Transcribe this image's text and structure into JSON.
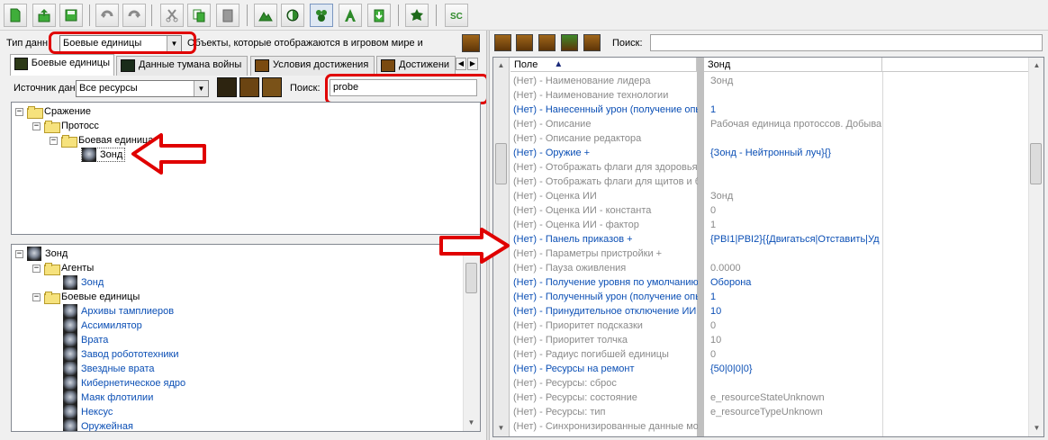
{
  "toolbar": {
    "buttons": [
      "new-file-icon",
      "open-file-icon",
      "save-icon",
      "undo-icon",
      "redo-icon",
      "cut-icon",
      "copy-icon",
      "paste-icon",
      "terrain-icon",
      "doodad-icon",
      "data-module-icon",
      "text-module-icon",
      "import-icon",
      "trigger-icon",
      "script-icon"
    ]
  },
  "left": {
    "data_type_label": "Тип данн",
    "data_type_value": "Боевые единицы",
    "data_type_desc": "Объекты, которые отображаются в игровом мире и",
    "tabs": [
      "Боевые единицы",
      "Данные тумана войны",
      "Условия достижения",
      "Достижени"
    ],
    "source_label": "Источник дан",
    "source_value": "Все ресурсы",
    "search_label": "Поиск:",
    "search_value": "probe",
    "tree": [
      {
        "label": "Сражение",
        "level": 0,
        "expander": "−"
      },
      {
        "label": "Протосс",
        "level": 1,
        "expander": "−"
      },
      {
        "label": "Боевая единица",
        "level": 2,
        "expander": "−"
      },
      {
        "label": "Зонд",
        "level": 3,
        "expander": ""
      }
    ],
    "deps_root": "Зонд",
    "deps": [
      {
        "label": "Агенты",
        "kind": "folder",
        "level": 1
      },
      {
        "label": "Зонд",
        "kind": "unit",
        "level": 2
      },
      {
        "label": "Боевые единицы",
        "kind": "folder",
        "level": 1
      },
      {
        "label": "Архивы тамплиеров",
        "kind": "unit",
        "level": 2
      },
      {
        "label": "Ассимилятор",
        "kind": "unit",
        "level": 2
      },
      {
        "label": "Врата",
        "kind": "unit",
        "level": 2
      },
      {
        "label": "Завод робототехники",
        "kind": "unit",
        "level": 2
      },
      {
        "label": "Звездные врата",
        "kind": "unit",
        "level": 2
      },
      {
        "label": "Кибернетическое ядро",
        "kind": "unit",
        "level": 2
      },
      {
        "label": "Маяк флотилии",
        "kind": "unit",
        "level": 2
      },
      {
        "label": "Нексус",
        "kind": "unit",
        "level": 2
      },
      {
        "label": "Оружейная",
        "kind": "unit",
        "level": 2
      }
    ]
  },
  "right": {
    "search_label": "Поиск:",
    "search_value": "",
    "col_field": "Поле",
    "col_value": "Зонд",
    "rows": [
      {
        "name": "(Нет) - Наименование лидера",
        "value": "Зонд",
        "mod": false
      },
      {
        "name": "(Нет) - Наименование технологии",
        "value": "",
        "mod": false
      },
      {
        "name": "(Нет) - Нанесенный урон (получение опы",
        "value": "1",
        "mod": true
      },
      {
        "name": "(Нет) - Описание",
        "value": "Рабочая единица протоссов. Добывае",
        "mod": false
      },
      {
        "name": "(Нет) - Описание редактора",
        "value": "",
        "mod": false
      },
      {
        "name": "(Нет) - Оружие +",
        "value": "{Зонд - Нейтронный луч}{}",
        "mod": true
      },
      {
        "name": "(Нет) - Отображать флаги для здоровья",
        "value": "",
        "mod": false
      },
      {
        "name": "(Нет) - Отображать флаги для щитов и б",
        "value": "",
        "mod": false
      },
      {
        "name": "(Нет) - Оценка ИИ",
        "value": "Зонд",
        "mod": false
      },
      {
        "name": "(Нет) - Оценка ИИ - константа",
        "value": "0",
        "mod": false
      },
      {
        "name": "(Нет) - Оценка ИИ - фактор",
        "value": "1",
        "mod": false
      },
      {
        "name": "(Нет) - Панель приказов +",
        "value": "{PBI1|PBI2}{{Двигаться|Отставить|Уд",
        "mod": true
      },
      {
        "name": "(Нет) - Параметры пристройки +",
        "value": "",
        "mod": false
      },
      {
        "name": "(Нет) - Пауза оживления",
        "value": "0.0000",
        "mod": false
      },
      {
        "name": "(Нет) - Получение уровня по умолчанию",
        "value": "Оборона",
        "mod": true
      },
      {
        "name": "(Нет) - Полученный урон (получение опы",
        "value": "1",
        "mod": true
      },
      {
        "name": "(Нет) - Принудительное отключение ИИ",
        "value": "10",
        "mod": true
      },
      {
        "name": "(Нет) - Приоритет подсказки",
        "value": "0",
        "mod": false
      },
      {
        "name": "(Нет) - Приоритет толчка",
        "value": "10",
        "mod": false
      },
      {
        "name": "(Нет) - Радиус погибшей единицы",
        "value": "0",
        "mod": false
      },
      {
        "name": "(Нет) - Ресурсы на ремонт",
        "value": "{50|0|0|0}",
        "mod": true
      },
      {
        "name": "(Нет) - Ресурсы: сброс",
        "value": "",
        "mod": false
      },
      {
        "name": "(Нет) - Ресурсы: состояние",
        "value": "e_resourceStateUnknown",
        "mod": false
      },
      {
        "name": "(Нет) - Ресурсы: тип",
        "value": "e_resourceTypeUnknown",
        "mod": false
      },
      {
        "name": "(Нет) - Синхронизированные данные мо",
        "value": "",
        "mod": false
      }
    ]
  },
  "colors": {
    "highlight": "#e00000",
    "modified": "#0b4fb5",
    "default_text": "#8a8a8a"
  }
}
